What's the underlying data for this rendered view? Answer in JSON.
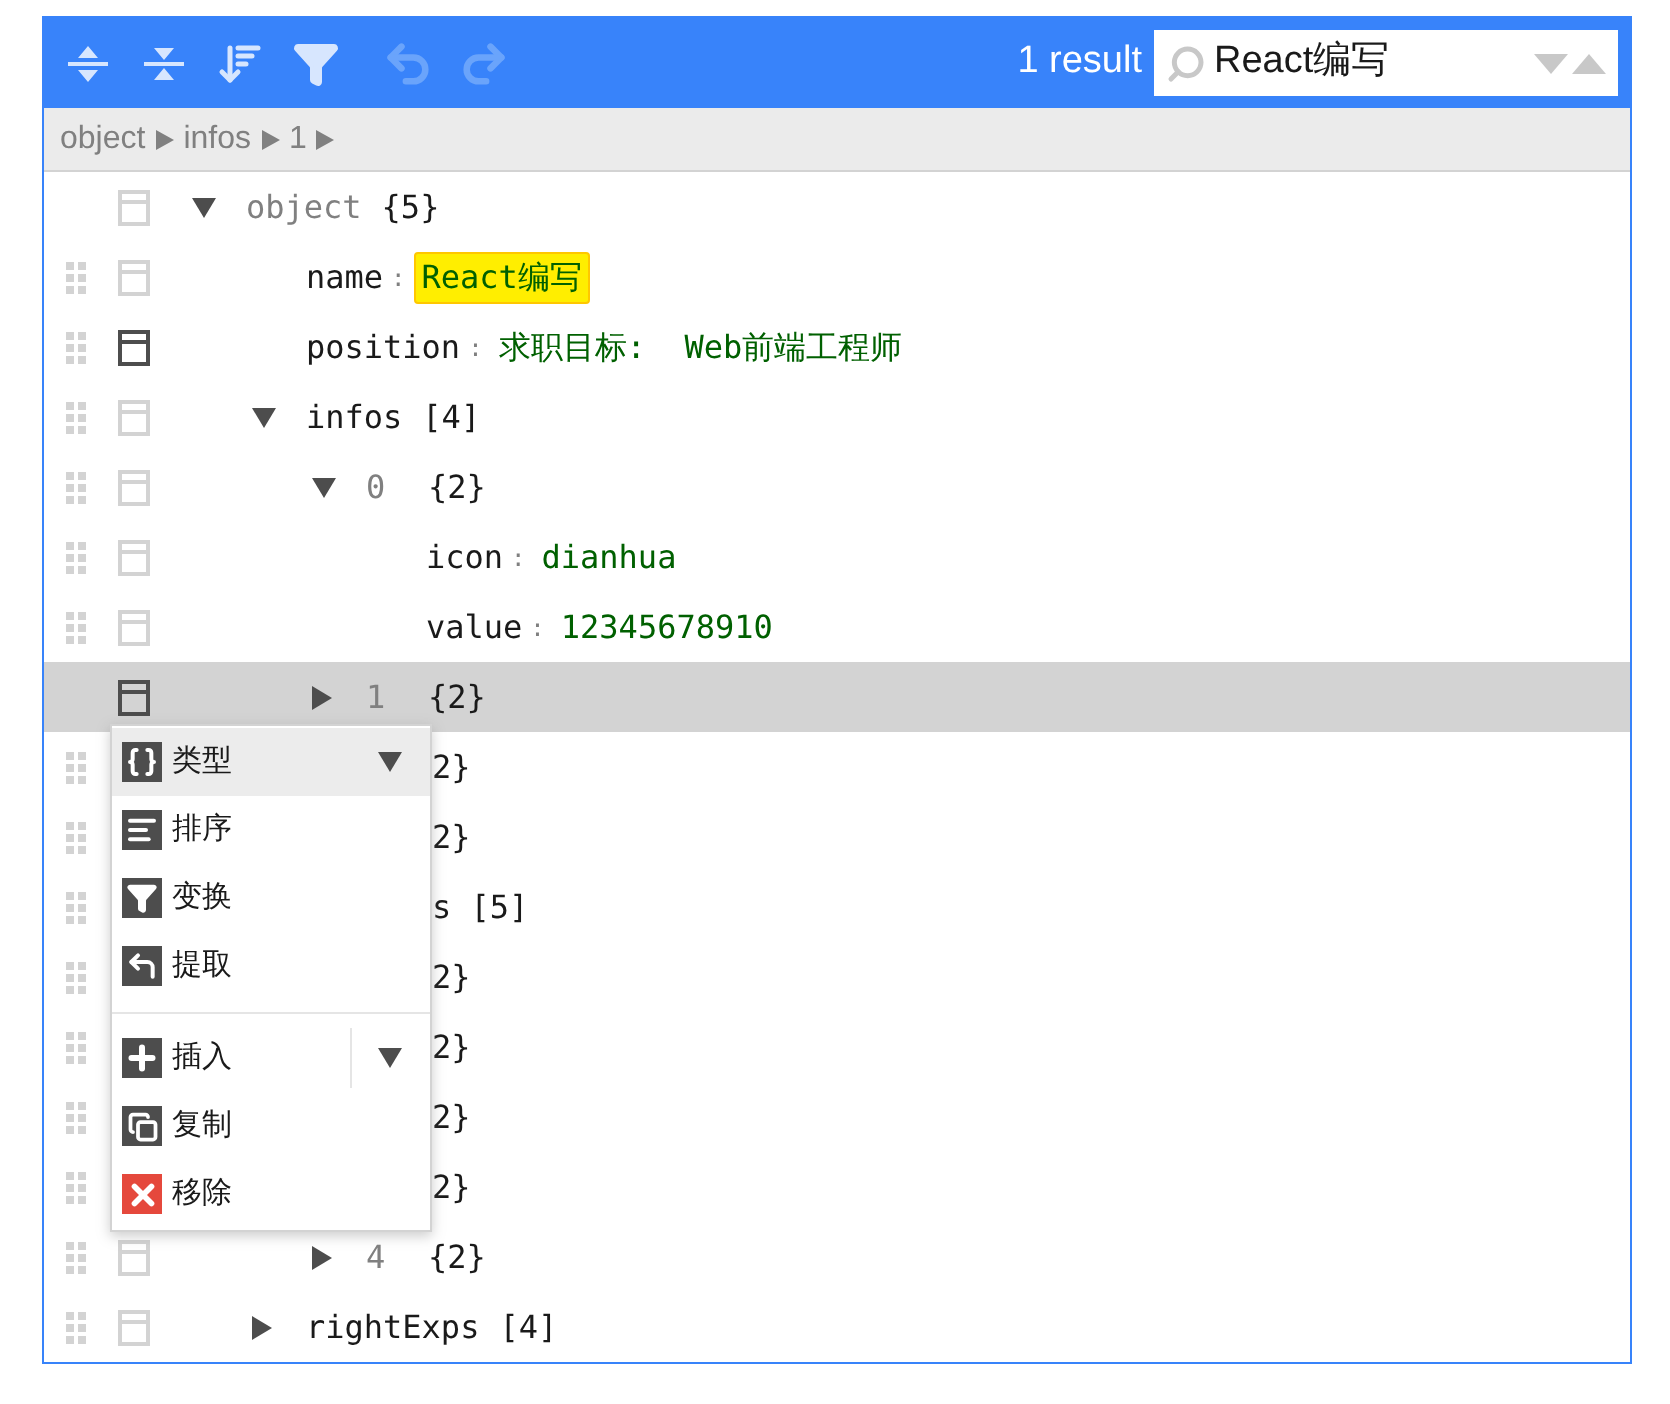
{
  "toolbar": {
    "buttons": [
      {
        "kind": "expand",
        "disabled": false
      },
      {
        "kind": "collapse",
        "disabled": false
      },
      {
        "kind": "sort",
        "disabled": false
      },
      {
        "kind": "filter",
        "disabled": false
      },
      {
        "kind": "undo",
        "disabled": true
      },
      {
        "kind": "redo",
        "disabled": true
      }
    ],
    "search": {
      "results": "1 result",
      "value": "React编写"
    }
  },
  "breadcrumb": [
    "object",
    "infos",
    "1"
  ],
  "tree": {
    "key": "object",
    "kind": "root",
    "count": "{5}",
    "expanded": true,
    "hovered": false,
    "children": [
      {
        "key": "name",
        "sep": ":",
        "value": "React编写",
        "search_match": true,
        "hovered": false
      },
      {
        "key": "position",
        "sep": ":",
        "value": "求职目标:  Web前端工程师",
        "search_match": false,
        "hovered": true
      },
      {
        "key": "infos",
        "count": "[4]",
        "expanded": true,
        "hovered": false,
        "children": [
          {
            "index": "0",
            "count": "{2}",
            "expanded": true,
            "hovered": false,
            "children": [
              {
                "key": "icon",
                "sep": ":",
                "value": "dianhua",
                "search_match": false,
                "hovered": false
              },
              {
                "key": "value",
                "sep": ":",
                "value": "12345678910",
                "search_match": false,
                "hovered": false
              }
            ]
          },
          {
            "index": "1",
            "count": "{2}",
            "expanded": false,
            "selected": true,
            "hovered": true
          },
          {
            "covered": true,
            "text": "2}"
          },
          {
            "covered": true,
            "text": "2}"
          }
        ]
      },
      {
        "covered": true,
        "text": "s [5]",
        "children": [
          {
            "covered": true,
            "text": "2}"
          },
          {
            "covered": true,
            "text": "2}"
          },
          {
            "covered": true,
            "text": "2}"
          },
          {
            "covered": true,
            "text": "2}"
          },
          {
            "index": "4",
            "count": "{2}",
            "expanded": false,
            "hovered": false
          }
        ]
      },
      {
        "key": "rightExps",
        "count": "[4]",
        "expanded": false,
        "hovered": false
      }
    ]
  },
  "context_menu": {
    "items": [
      {
        "kind": "type",
        "label": "类型",
        "submenu": true,
        "selected": true
      },
      {
        "kind": "sort",
        "label": "排序",
        "submenu": false,
        "selected": false
      },
      {
        "kind": "transform",
        "label": "变换",
        "submenu": false,
        "selected": false
      },
      {
        "kind": "extract",
        "label": "提取",
        "submenu": false,
        "selected": false
      },
      {
        "kind": "separator"
      },
      {
        "kind": "insert",
        "label": "插入",
        "submenu": true,
        "split": true,
        "selected": false
      },
      {
        "kind": "duplicate",
        "label": "复制",
        "submenu": false,
        "selected": false
      },
      {
        "kind": "remove",
        "label": "移除",
        "submenu": false,
        "selected": false
      }
    ]
  }
}
